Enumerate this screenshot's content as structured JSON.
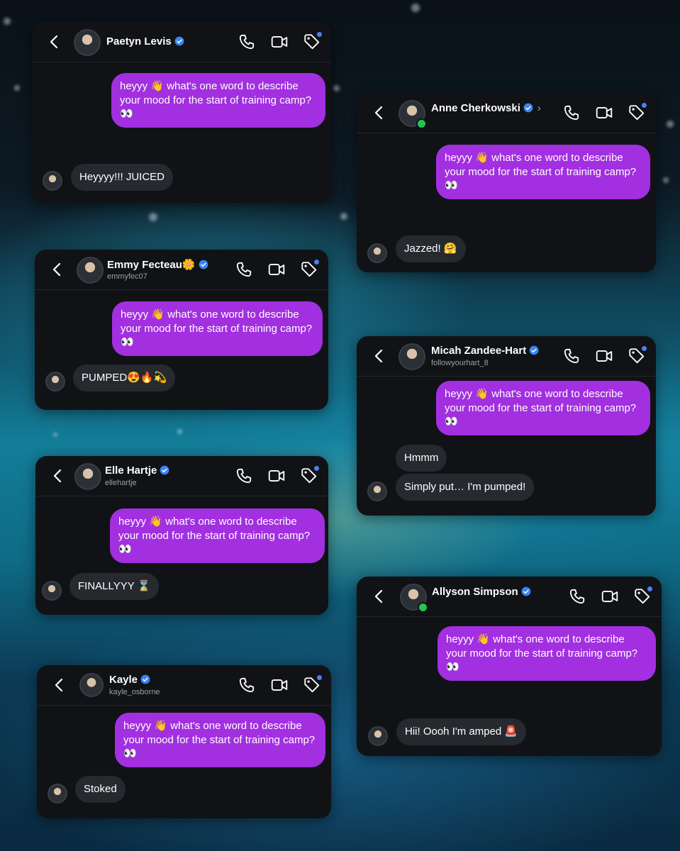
{
  "prompt_text": "heyyy 👋 what's one word to describe your mood for the start of training camp? 👀",
  "colors": {
    "sent_bubble": "#a22fe0",
    "received_bubble": "#26292e",
    "card": "#101216",
    "verified": "#3b82f6",
    "online": "#23c552"
  },
  "icons": [
    "back-chevron-icon",
    "verified-badge-icon",
    "phone-icon",
    "video-camera-icon",
    "tag-icon"
  ],
  "chats": {
    "paetyn": {
      "name": "Paetyn Levis",
      "handle": "",
      "replies": [
        "Heyyyy!!! JUICED"
      ]
    },
    "anne": {
      "name": "Anne Cherkowski",
      "handle": "",
      "replies": [
        "Jazzed! 🤗"
      ]
    },
    "emmy": {
      "name": "Emmy Fecteau🌼",
      "handle": "emmyfec07",
      "replies": [
        "PUMPED😍🔥💫"
      ]
    },
    "micah": {
      "name": "Micah Zandee-Hart",
      "handle": "followyourhart_8",
      "replies": [
        "Hmmm",
        "Simply put… I'm pumped!"
      ]
    },
    "elle": {
      "name": "Elle Hartje",
      "handle": "ellehartje",
      "replies": [
        "FINALLYYY ⌛"
      ]
    },
    "allyson": {
      "name": "Allyson Simpson",
      "handle": "",
      "replies": [
        "Hii! Oooh I'm amped 🚨"
      ]
    },
    "kayle": {
      "name": "Kayle",
      "handle": "kayle_osborne",
      "replies": [
        "Stoked"
      ]
    }
  }
}
